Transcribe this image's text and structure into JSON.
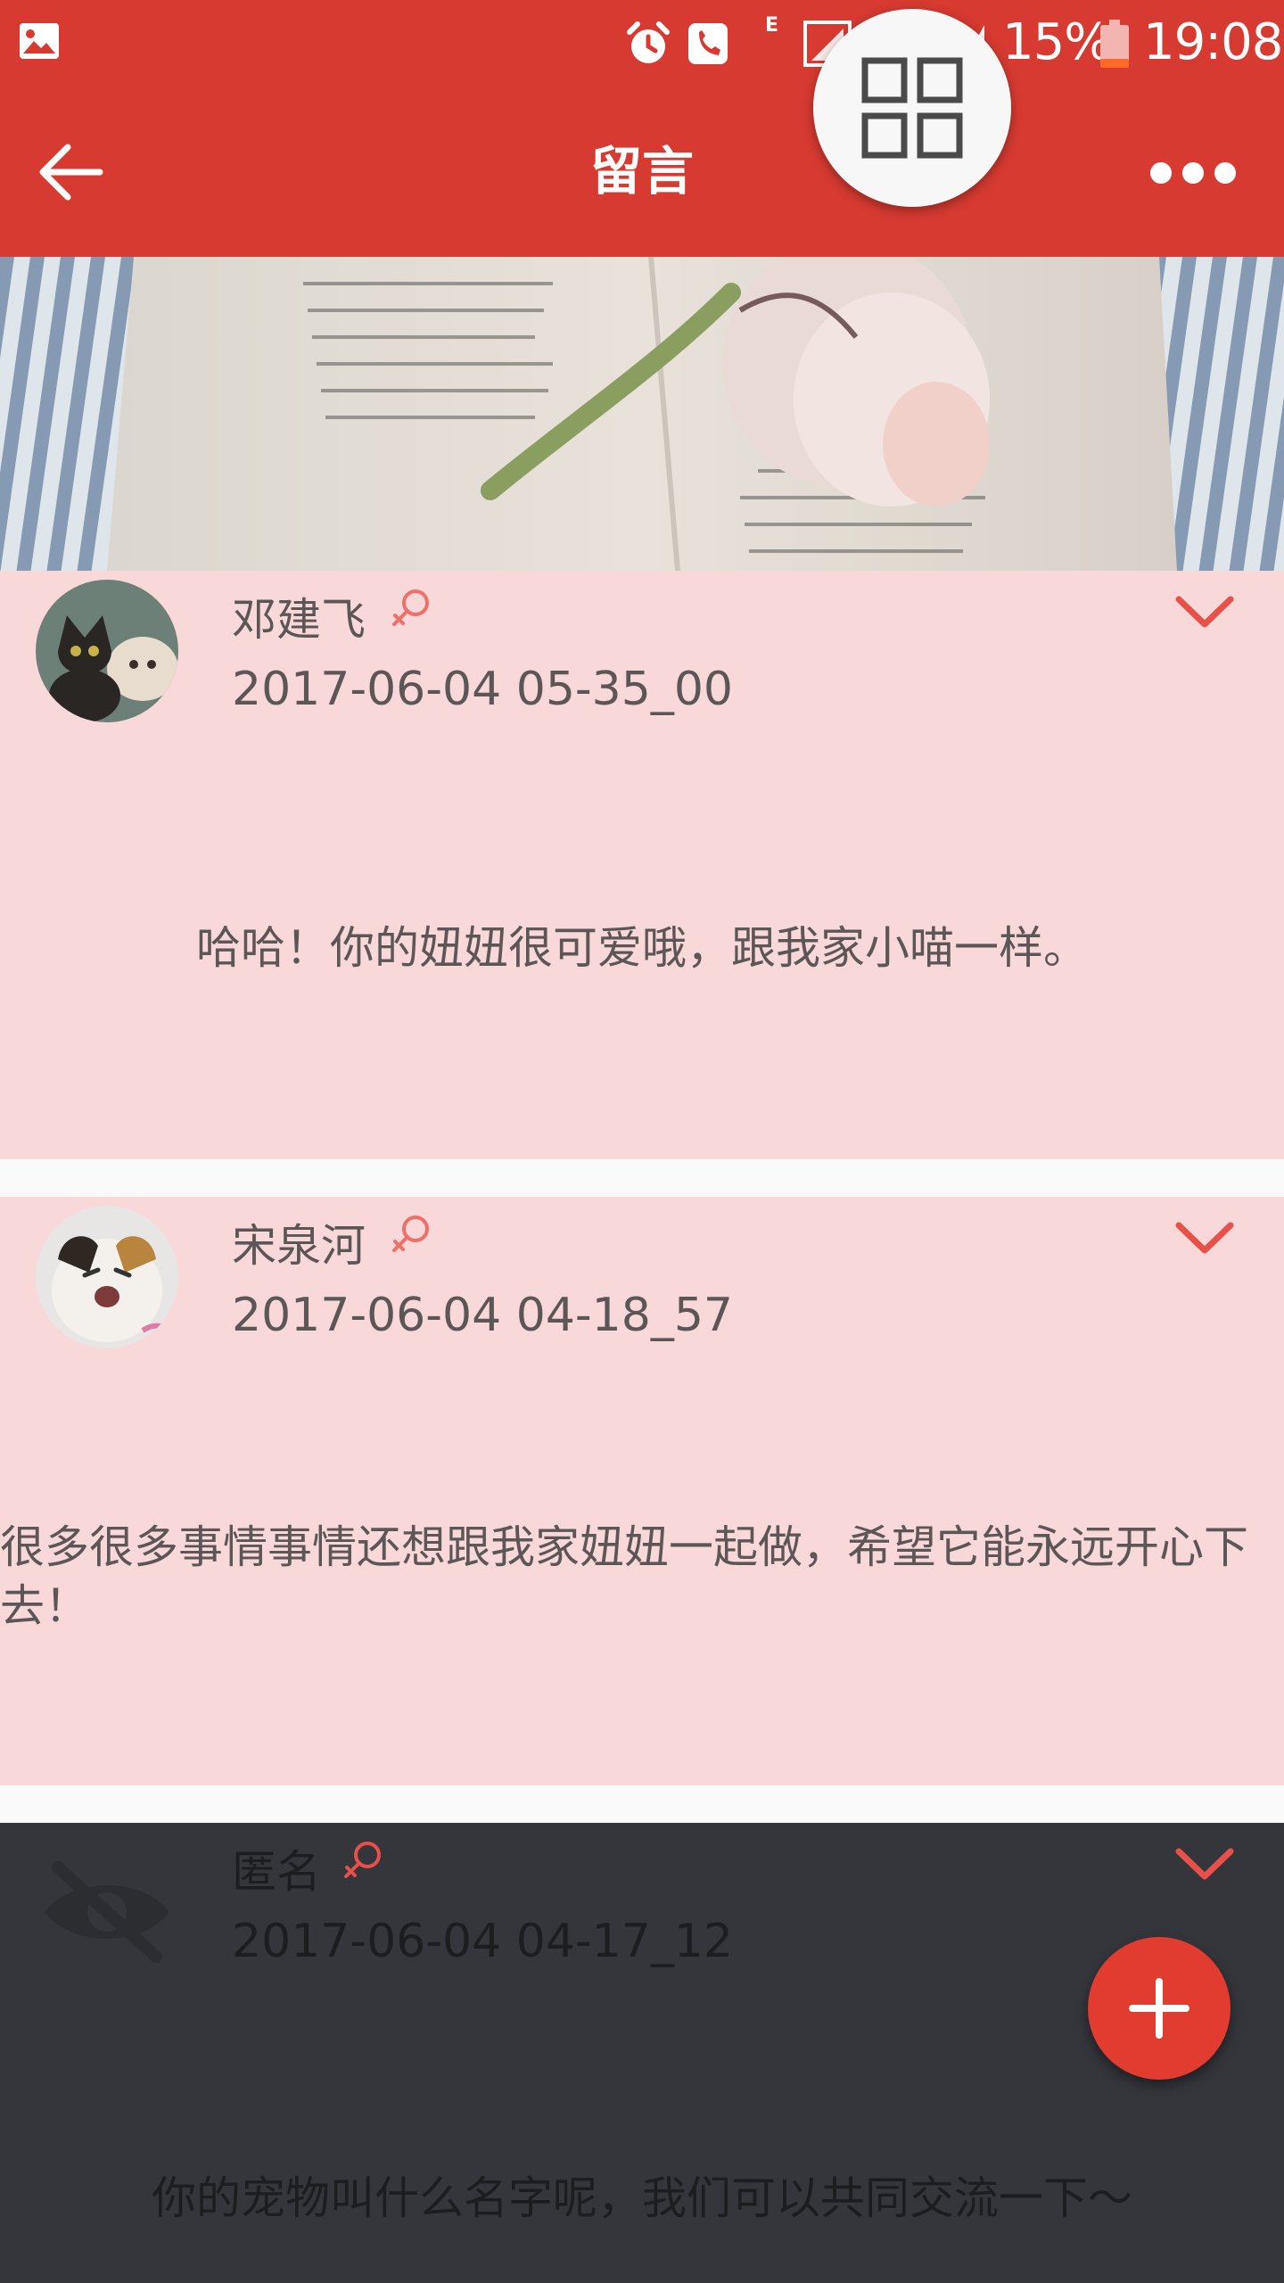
{
  "status_bar": {
    "battery": "15%",
    "time": "19:08",
    "network": "E",
    "icons": [
      "gallery-icon",
      "alarm-icon",
      "call-icon",
      "signal-icon",
      "battery-icon"
    ]
  },
  "app_bar": {
    "title": "留言",
    "back_icon": "arrow-left-icon",
    "more_icon": "more-dots-icon",
    "float_button_icon": "grid-icon"
  },
  "colors": {
    "primary": "#d63a31",
    "card_pink": "#f8d8d8",
    "card_dark": "#34363b",
    "accent_red": "#e8504a"
  },
  "messages": [
    {
      "author": "邓建飞",
      "gender_icon": "female-icon",
      "time": "2017-06-04 05-35_00",
      "content": "哈哈！你的妞妞很可爱哦，跟我家小喵一样。"
    },
    {
      "author": "宋泉河",
      "gender_icon": "female-icon",
      "time": "2017-06-04 04-18_57",
      "content": "很多很多事情事情还想跟我家妞妞一起做，希望它能永远开心下去！"
    },
    {
      "author": "匿名",
      "gender_icon": "female-icon",
      "time": "2017-06-04 04-17_12",
      "content": "你的宠物叫什么名字呢，我们可以共同交流一下～"
    }
  ],
  "fab": {
    "icon": "plus-icon"
  }
}
